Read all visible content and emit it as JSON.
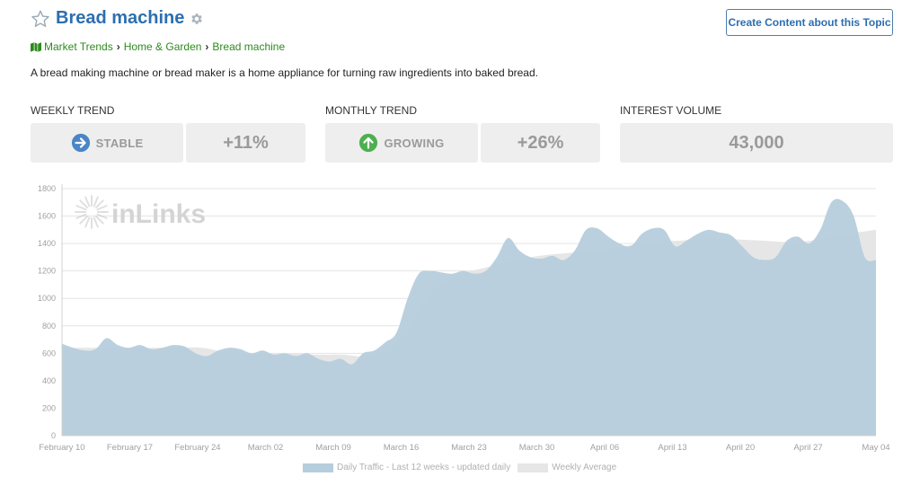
{
  "header": {
    "title": "Bread machine",
    "create_button": "Create Content about this Topic"
  },
  "breadcrumb": [
    "Market Trends",
    "Home & Garden",
    "Bread machine"
  ],
  "description": "A bread making machine or bread maker is a home appliance for turning raw ingredients into baked bread.",
  "metrics": {
    "weekly": {
      "label": "WEEKLY TREND",
      "status": "STABLE",
      "change": "+11%"
    },
    "monthly": {
      "label": "MONTHLY TREND",
      "status": "GROWING",
      "change": "+26%"
    },
    "volume": {
      "label": "INTEREST VOLUME",
      "value": "43,000"
    }
  },
  "watermark": "inLinks",
  "colors": {
    "title": "#2c6fb0",
    "breadcrumb": "#2e8a1e",
    "stable_icon": "#4a86c5",
    "growing_icon": "#4caf50",
    "daily_fill": "#b6cddc",
    "weekly_fill": "#e6e6e6"
  },
  "chart_data": {
    "type": "area",
    "ylim": [
      0,
      1800
    ],
    "yticks": [
      0,
      200,
      400,
      600,
      800,
      1000,
      1200,
      1400,
      1600,
      1800
    ],
    "xticks": [
      "February 10",
      "February 17",
      "February 24",
      "March 02",
      "March 09",
      "March 16",
      "March 23",
      "March 30",
      "April 06",
      "April 13",
      "April 20",
      "April 27",
      "May 04"
    ],
    "legend_position": "bottom",
    "grid": true,
    "series": [
      {
        "name": "Daily Traffic - Last 12 weeks - updated daily",
        "values": [
          670,
          640,
          620,
          630,
          710,
          660,
          640,
          660,
          630,
          640,
          660,
          650,
          600,
          580,
          620,
          640,
          630,
          600,
          620,
          590,
          600,
          580,
          600,
          560,
          540,
          560,
          520,
          600,
          620,
          680,
          750,
          1000,
          1180,
          1200,
          1190,
          1180,
          1200,
          1180,
          1200,
          1300,
          1440,
          1350,
          1300,
          1290,
          1310,
          1280,
          1350,
          1500,
          1510,
          1450,
          1400,
          1380,
          1470,
          1510,
          1500,
          1380,
          1420,
          1470,
          1500,
          1480,
          1460,
          1380,
          1300,
          1280,
          1300,
          1420,
          1450,
          1400,
          1500,
          1700,
          1710,
          1600,
          1300,
          1280
        ]
      },
      {
        "name": "Weekly Average",
        "values": [
          640,
          640,
          640,
          640,
          640,
          640,
          600,
          600,
          600,
          590,
          590,
          580,
          680,
          1000,
          1160,
          1220,
          1270,
          1310,
          1330,
          1350,
          1380,
          1410,
          1420,
          1440,
          1430,
          1420,
          1410,
          1430,
          1470,
          1500
        ]
      }
    ]
  }
}
